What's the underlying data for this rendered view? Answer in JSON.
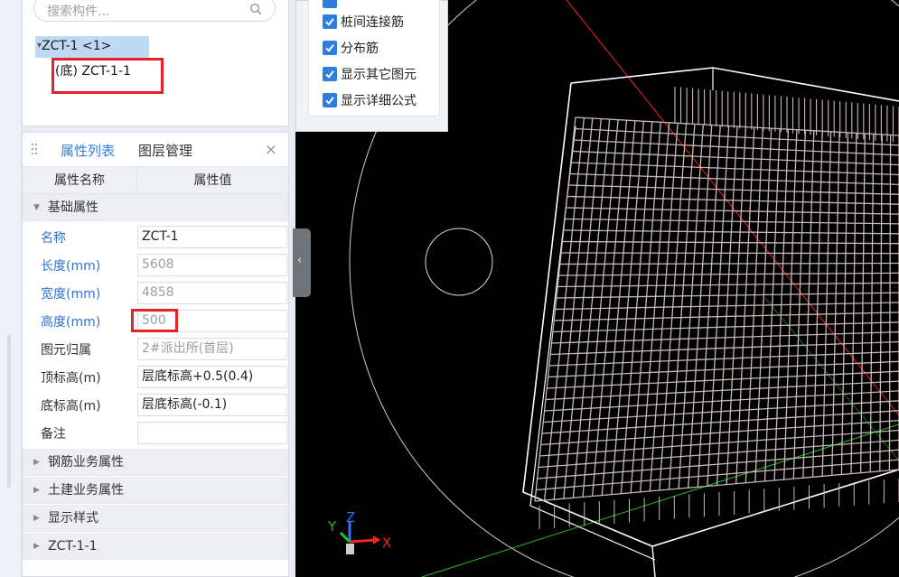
{
  "tree_panel": {
    "search_placeholder": "搜索构件...",
    "node_label": "ZCT-1 <1>",
    "child_label": "(底) ZCT-1-1"
  },
  "props_panel": {
    "tab_active": "属性列表",
    "tab_other": "图层管理",
    "close": "×",
    "col_name": "属性名称",
    "col_value": "属性值",
    "group_basic": "基础属性",
    "rows": [
      {
        "name": "名称",
        "value": "ZCT-1"
      },
      {
        "name": "长度(mm)",
        "value": "5608"
      },
      {
        "name": "宽度(mm)",
        "value": "4858"
      },
      {
        "name": "高度(mm)",
        "value": "500"
      },
      {
        "name": "图元归属",
        "value": "2#派出所(首层)"
      },
      {
        "name": "顶标高(m)",
        "value": "层底标高+0.5(0.4)"
      },
      {
        "name": "底标高(m)",
        "value": "层底标高(-0.1)"
      },
      {
        "name": "备注",
        "value": ""
      }
    ],
    "groups_collapsed": [
      "钢筋业务属性",
      "土建业务属性",
      "显示样式",
      "ZCT-1-1"
    ]
  },
  "display_options": {
    "items": [
      "桩间连接筋",
      "分布筋",
      "显示其它图元",
      "显示详细公式"
    ]
  },
  "viewport": {
    "axis_x": "X",
    "axis_y": "Y",
    "axis_z": "Z",
    "colors": {
      "x_axis": "#ff2020",
      "y_axis": "#20c020",
      "z_axis": "#3a6cff",
      "rebar": "#c8b8b8",
      "outline": "#ffffff"
    }
  }
}
